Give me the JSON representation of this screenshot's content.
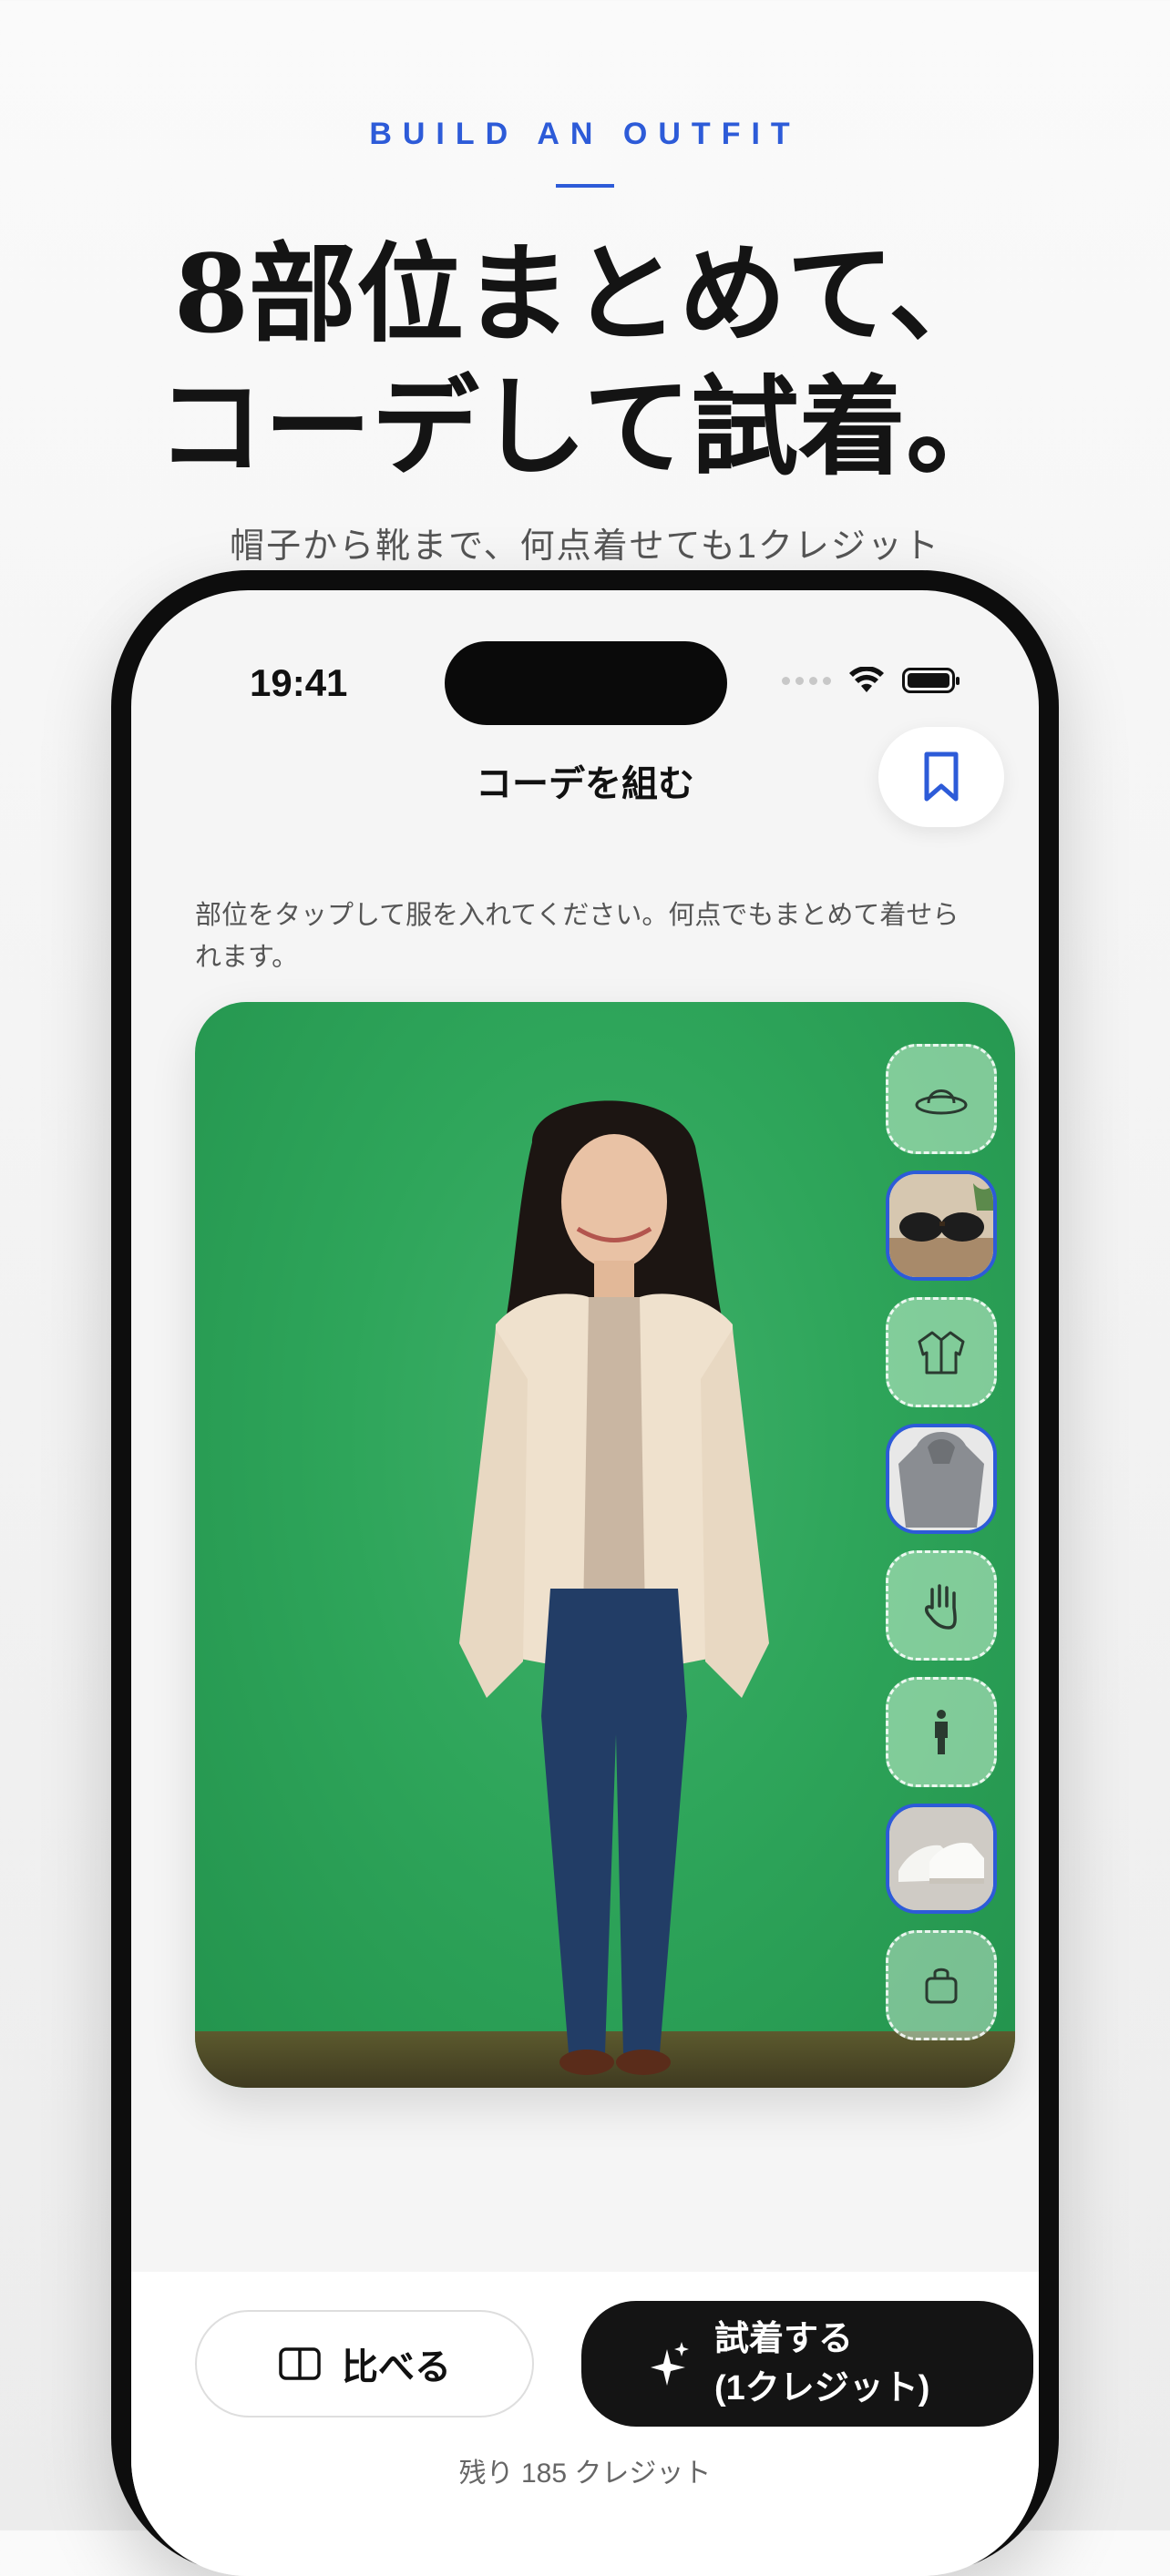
{
  "hero": {
    "eyebrow": "BUILD AN OUTFIT",
    "headline_line1": "8部位まとめて、",
    "headline_line2": "コーデして試着。",
    "subcopy": "帽子から靴まで、何点着せても1クレジット"
  },
  "status_bar": {
    "time": "19:41"
  },
  "nav": {
    "title": "コーデを組む",
    "bookmark_icon": "bookmark-icon"
  },
  "instruction": "部位をタップして服を入れてください。何点でもまとめて着せられます。",
  "slots": [
    {
      "icon": "hat-icon",
      "state": "empty"
    },
    {
      "icon": "sunglasses-photo",
      "state": "filled"
    },
    {
      "icon": "jacket-icon",
      "state": "empty"
    },
    {
      "icon": "hoodie-photo",
      "state": "filled"
    },
    {
      "icon": "hand-icon",
      "state": "empty"
    },
    {
      "icon": "person-icon",
      "state": "empty"
    },
    {
      "icon": "sneakers-photo",
      "state": "filled"
    },
    {
      "icon": "bag-icon",
      "state": "empty"
    }
  ],
  "actions": {
    "compare_label": "比べる",
    "tryon_label": "試着する\n(1クレジット)"
  },
  "credits_text": "残り 185 クレジット",
  "colors": {
    "accent": "#2d5bd8",
    "green_screen": "#2ea55a",
    "primary_button": "#141414"
  }
}
